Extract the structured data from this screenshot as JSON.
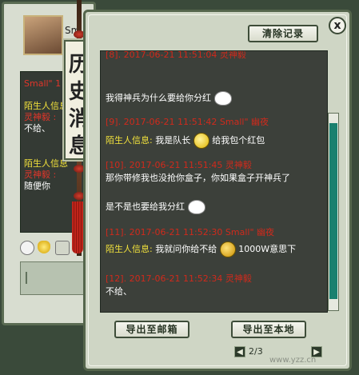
{
  "background_window": {
    "name": "Sm",
    "chat_lines": [
      {
        "text": "Small\" 1",
        "color": "#e0352a"
      },
      {
        "text": "陌生人信息",
        "color": "#f1e13c"
      },
      {
        "text": "灵神毅 :",
        "color": "#e0352a"
      },
      {
        "text": "不给、",
        "color": "#ffffff"
      },
      {
        "text": "陌生人信息",
        "color": "#f1e13c"
      },
      {
        "text": "灵神毅 :",
        "color": "#e0352a"
      },
      {
        "text": "随便你",
        "color": "#ffffff"
      }
    ],
    "input_hint": "I"
  },
  "banner": {
    "chars": [
      "历",
      "史",
      "消",
      "息"
    ]
  },
  "toolbar": {
    "clear_label": "清除记录",
    "close_label": "x"
  },
  "chat": {
    "lines": [
      {
        "kind": "stamp",
        "text": "[8].  2017-06-21  11:51:04  灵神毅"
      },
      {
        "kind": "text",
        "text": "我得神兵为什么要给你分红"
      },
      {
        "kind": "stamp",
        "text": "[9].  2017-06-21  11:51:42  Small\" 幽夜"
      },
      {
        "kind": "mixed",
        "label": "陌生人信息:",
        "text_before": "我是队长",
        "text_after": "给我包个红包"
      },
      {
        "kind": "stamp",
        "text": "[10].  2017-06-21  11:51:45  灵神毅"
      },
      {
        "kind": "text",
        "text": "那你带修我也没抢你盒子，你如果盒子开神兵了"
      },
      {
        "kind": "text",
        "text": "是不是也要给我分红"
      },
      {
        "kind": "stamp",
        "text": "[11].  2017-06-21  11:52:30  Small\" 幽夜"
      },
      {
        "kind": "mixed",
        "label": "陌生人信息:",
        "text_before": "我就问你给不给",
        "text_after": "1000W意思下"
      },
      {
        "kind": "stamp",
        "text": "[12].  2017-06-21  11:52:34  灵神毅"
      },
      {
        "kind": "text",
        "text": "不给、"
      }
    ]
  },
  "footer": {
    "export_mail": "导出至邮箱",
    "export_local": "导出至本地",
    "page_prev": "◀",
    "page_next": "▶",
    "page_info": "2/3",
    "watermark": "www.yzz.cn"
  },
  "colors": {
    "stamp": "#d02a1c",
    "label": "#f1e13c",
    "text": "#ffffff",
    "scroll_thumb": "#19806f"
  }
}
